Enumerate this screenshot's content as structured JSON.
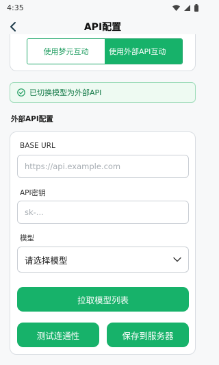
{
  "status_bar": {
    "time": "4:35"
  },
  "app_bar": {
    "title": "API配置"
  },
  "mode_selector": {
    "options": [
      "使用梦元互动",
      "使用外部API互动"
    ],
    "selected_index": 1
  },
  "notice": {
    "text": "已切换模型为外部API"
  },
  "section": {
    "title": "外部API配置"
  },
  "form": {
    "base_url": {
      "label": "BASE URL",
      "placeholder": "https://api.example.com"
    },
    "api_key": {
      "label": "API密钥",
      "placeholder": "sk-..."
    },
    "model": {
      "label": "模型",
      "value": "请选择模型"
    }
  },
  "buttons": {
    "fetch_models": "拉取模型列表",
    "test_connection": "测试连通性",
    "save_to_server": "保存到服务器"
  },
  "colors": {
    "primary": "#17b26a",
    "notice_bg": "#eefaf2",
    "notice_text": "#157a48"
  },
  "icons": {
    "back": "chevron-left-icon",
    "notice": "check-circle-icon",
    "select": "chevron-down-icon"
  }
}
